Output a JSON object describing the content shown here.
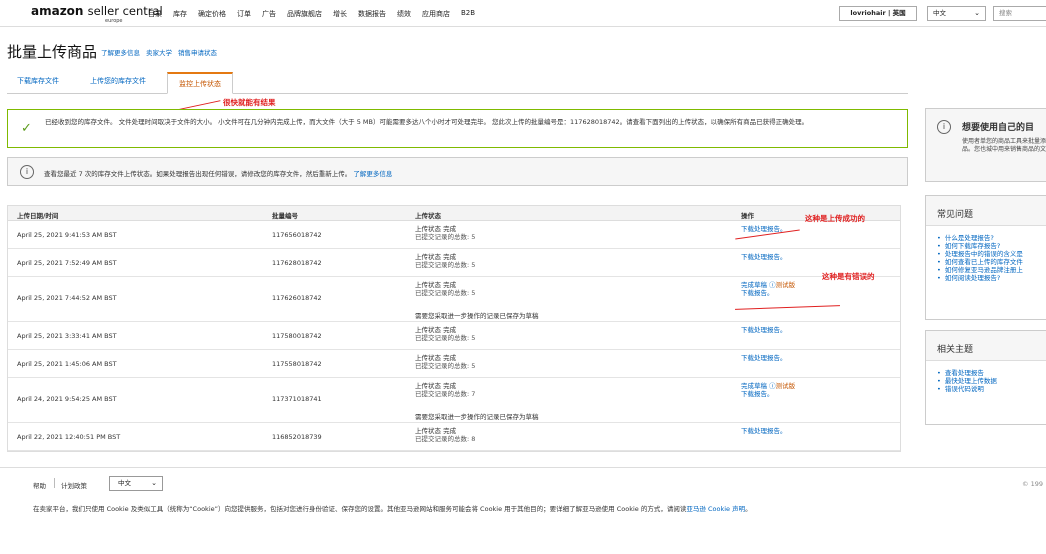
{
  "header": {
    "logo_main": "amazon",
    "logo_sub": "seller central",
    "logo_region": "europe",
    "nav": [
      "目录",
      "库存",
      "确定价格",
      "订单",
      "广告",
      "品牌旗舰店",
      "增长",
      "数据报告",
      "绩效",
      "应用商店",
      "B2B"
    ],
    "account": "lovriohair | 英国",
    "language": "中文",
    "search_placeholder": "搜索"
  },
  "page": {
    "title": "批量上传商品",
    "title_links": [
      "了解更多信息",
      "卖家大学",
      "销售申请状态"
    ]
  },
  "tabs": [
    {
      "label": "下载库存文件",
      "active": false
    },
    {
      "label": "上传您的库存文件",
      "active": false
    },
    {
      "label": "监控上传状态",
      "active": true
    }
  ],
  "annotations": {
    "tab_note": "很快就能有结果",
    "success_note": "这种是上传成功的",
    "error_note": "这种是有错误的"
  },
  "success_message": "已经收到您的库存文件。 文件处理时间取决于文件的大小。 小文件可在几分钟内完成上传，而大文件（大于 5 MB）可能需要多达八个小时才可处理完毕。 您此次上传的批量编号是：117628018742。请查看下面列出的上传状态，以确保所有商品已获得正确处理。",
  "info_message": {
    "text": "查看您最近 7 次的库存文件上传状态。如果处理报告出现任何错误，请修改您的库存文件，然后重新上传。",
    "link": "了解更多信息"
  },
  "table": {
    "headers": {
      "date": "上传日期/时间",
      "batch": "批量编号",
      "status": "上传状态",
      "action": "操作"
    },
    "rows": [
      {
        "date": "April 25, 2021 9:41:53 AM BST",
        "batch": "117656018742",
        "status": "上传状态 完成",
        "records": "已提交记录的总数: 5",
        "note": "",
        "draft": "",
        "beta": "",
        "action": "下载处理报告。"
      },
      {
        "date": "April 25, 2021 7:52:49 AM BST",
        "batch": "117628018742",
        "status": "上传状态 完成",
        "records": "已提交记录的总数: 5",
        "note": "",
        "draft": "",
        "beta": "",
        "action": "下载处理报告。"
      },
      {
        "date": "April 25, 2021 7:44:52 AM BST",
        "batch": "117626018742",
        "status": "上传状态 完成",
        "records": "已提交记录的总数: 5",
        "note": "需要您采取进一步操作的记录已保存为草稿",
        "draft": "完成草稿",
        "beta": "测试版",
        "action": "下载报告。"
      },
      {
        "date": "April 25, 2021 3:33:41 AM BST",
        "batch": "117580018742",
        "status": "上传状态 完成",
        "records": "已提交记录的总数: 5",
        "note": "",
        "draft": "",
        "beta": "",
        "action": "下载处理报告。"
      },
      {
        "date": "April 25, 2021 1:45:06 AM BST",
        "batch": "117558018742",
        "status": "上传状态 完成",
        "records": "已提交记录的总数: 5",
        "note": "",
        "draft": "",
        "beta": "",
        "action": "下载处理报告。"
      },
      {
        "date": "April 24, 2021 9:54:25 AM BST",
        "batch": "117371018741",
        "status": "上传状态 完成",
        "records": "已提交记录的总数: 7",
        "note": "需要您采取进一步操作的记录已保存为草稿",
        "draft": "完成草稿",
        "beta": "测试版",
        "action": "下载报告。"
      },
      {
        "date": "April 22, 2021 12:40:51 PM BST",
        "batch": "116852018739",
        "status": "上传状态 完成",
        "records": "已提交记录的总数: 8",
        "note": "",
        "draft": "",
        "beta": "",
        "action": "下载处理报告。"
      }
    ]
  },
  "sidebar": {
    "promo_title": "想要使用自己的目",
    "promo_text": "使用者单您的商品工具来批量添加商品。您也城中用来销售商品的文",
    "faq_title": "常见问题",
    "faq_items": [
      "什么是处理报告?",
      "如何下载库存报告?",
      "处理报告中的错误的含义是",
      "如何查看已上传的库存文件",
      "如何修复亚马逊品牌注册上",
      "如何阅读处理报告?"
    ],
    "related_title": "相关主题",
    "related_items": [
      "查看处理报告",
      "最快处理上传数据",
      "错误代码说明"
    ]
  },
  "footer": {
    "help": "帮助",
    "policy": "计划政策",
    "language": "中文",
    "copyright": "© 199",
    "cookie_text": "在卖家平台，我们只使用 Cookie 及类似工具（统称为“Cookie”）向您提供服务，包括对您进行身份验证、保存您的设置。其他亚马逊网站和服务可能会将 Cookie 用于其他目的；要详细了解亚马逊使用 Cookie 的方式，请阅读",
    "cookie_link": "亚马逊 Cookie 声明",
    "cookie_end": "。"
  }
}
